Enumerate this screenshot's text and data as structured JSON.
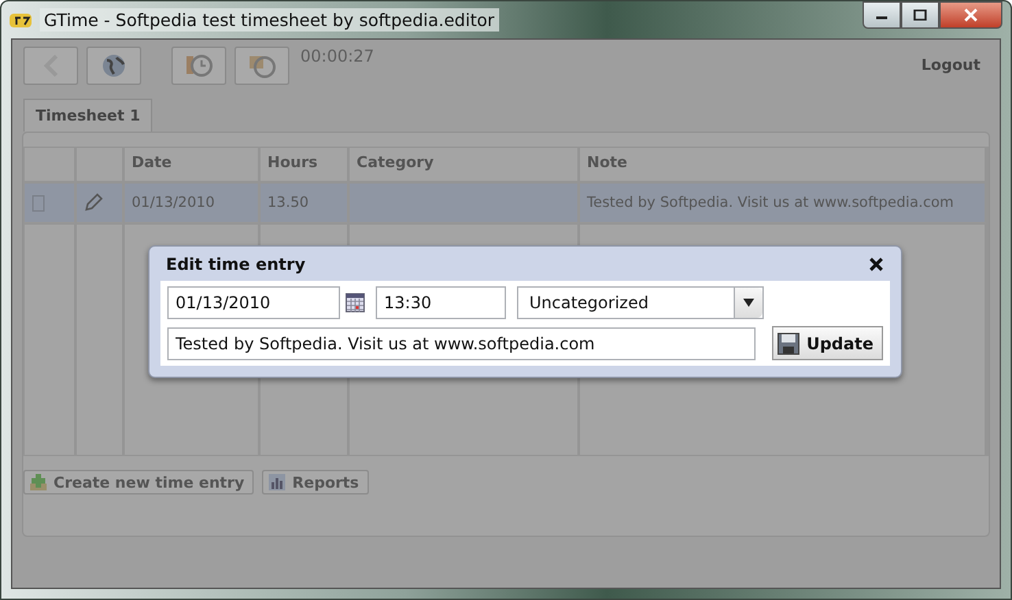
{
  "window": {
    "title": "GTime - Softpedia test timesheet by softpedia.editor"
  },
  "toolbar": {
    "timer": "00:00:27",
    "logout": "Logout"
  },
  "tabs": [
    {
      "label": "Timesheet 1",
      "selected": true
    }
  ],
  "table": {
    "columns": [
      "Date",
      "Hours",
      "Category",
      "Note"
    ],
    "rows": [
      {
        "selected": true,
        "date": "01/13/2010",
        "hours": "13.50",
        "note": "Tested by Softpedia. Visit us at www.softpedia.com"
      }
    ]
  },
  "buttons": [
    {
      "kind": "create",
      "label": "Create new time entry"
    },
    {
      "kind": "reports",
      "label": "Reports"
    }
  ],
  "dialog": {
    "title": "Edit time entry",
    "date": "01/13/2010",
    "time": "13:30",
    "category": "Uncategorized",
    "note": "Tested by Softpedia. Visit us at www.softpedia.com",
    "button": "Update"
  }
}
